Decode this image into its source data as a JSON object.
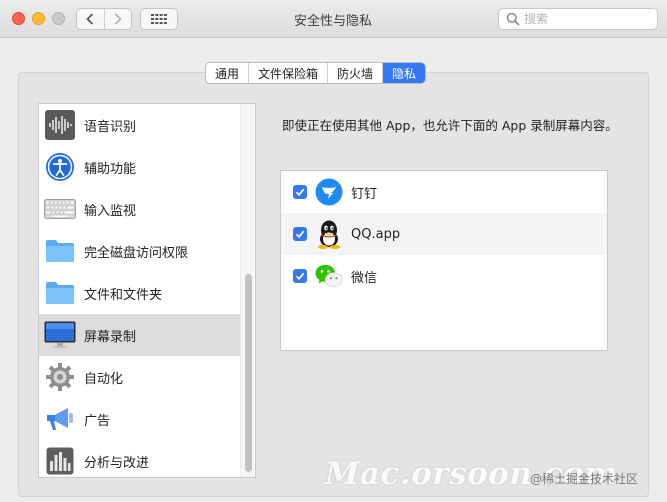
{
  "window": {
    "title": "安全性与隐私",
    "search_placeholder": "搜索"
  },
  "tabs": [
    {
      "label": "通用",
      "active": false
    },
    {
      "label": "文件保险箱",
      "active": false
    },
    {
      "label": "防火墙",
      "active": false
    },
    {
      "label": "隐私",
      "active": true
    }
  ],
  "sidebar": {
    "items": [
      {
        "label": "语音识别",
        "icon": "speech-recognition-icon"
      },
      {
        "label": "辅助功能",
        "icon": "accessibility-icon"
      },
      {
        "label": "输入监视",
        "icon": "keyboard-icon"
      },
      {
        "label": "完全磁盘访问权限",
        "icon": "folder-icon"
      },
      {
        "label": "文件和文件夹",
        "icon": "folder-icon"
      },
      {
        "label": "屏幕录制",
        "icon": "display-icon",
        "selected": true
      },
      {
        "label": "自动化",
        "icon": "gear-icon"
      },
      {
        "label": "广告",
        "icon": "megaphone-icon"
      },
      {
        "label": "分析与改进",
        "icon": "chart-icon"
      }
    ]
  },
  "main": {
    "description": "即使正在使用其他 App，也允许下面的 App 录制屏幕内容。",
    "apps": [
      {
        "label": "钉钉",
        "checked": true,
        "icon": "dingtalk-icon"
      },
      {
        "label": "QQ.app",
        "checked": true,
        "icon": "qq-icon"
      },
      {
        "label": "微信",
        "checked": true,
        "icon": "wechat-icon"
      }
    ]
  },
  "watermark": {
    "main": "Mac.orsoon.com",
    "sub": "@稀土掘金技术社区"
  },
  "colors": {
    "accent": "#3478f6",
    "close": "#fe5f57",
    "minimize": "#febc2e",
    "maximize": "#c9c9c9"
  }
}
